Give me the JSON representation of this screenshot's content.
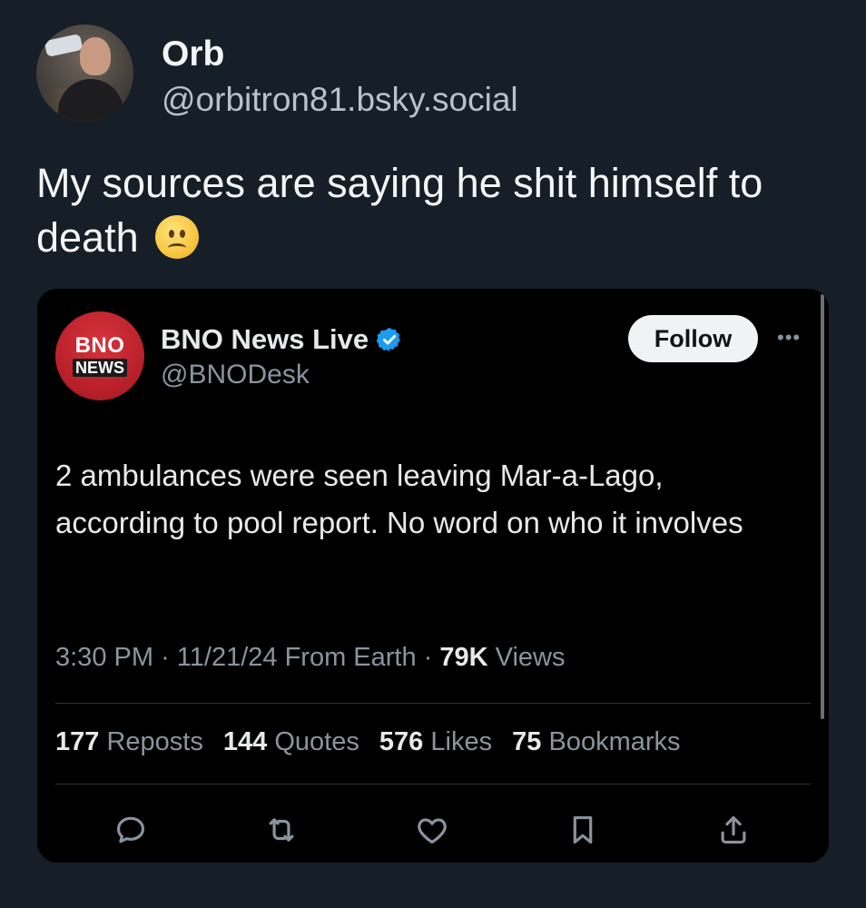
{
  "post": {
    "display_name": "Orb",
    "handle": "@orbitron81.bsky.social",
    "text": "My sources are saying he shit himself to death",
    "emoji": "slightly-frowning-face"
  },
  "embed": {
    "logo_top": "BNO",
    "logo_bottom": "NEWS",
    "name": "BNO News Live",
    "verified": true,
    "handle": "@BNODesk",
    "follow_label": "Follow",
    "more_label": "•••",
    "text": "2 ambulances were seen leaving Mar-a-Lago, according to pool report. No word on who it involves",
    "meta": {
      "time": "3:30 PM",
      "date": "11/21/24",
      "source": "From Earth",
      "views_count": "79K",
      "views_label": "Views"
    },
    "stats": [
      {
        "count": "177",
        "label": "Reposts"
      },
      {
        "count": "144",
        "label": "Quotes"
      },
      {
        "count": "576",
        "label": "Likes"
      },
      {
        "count": "75",
        "label": "Bookmarks"
      }
    ],
    "actions": [
      "reply-icon",
      "repost-icon",
      "like-icon",
      "bookmark-icon",
      "share-icon"
    ]
  },
  "colors": {
    "background": "#161e27",
    "card": "#000000",
    "verified": "#1d9bf0",
    "bno_red": "#c8252e"
  }
}
